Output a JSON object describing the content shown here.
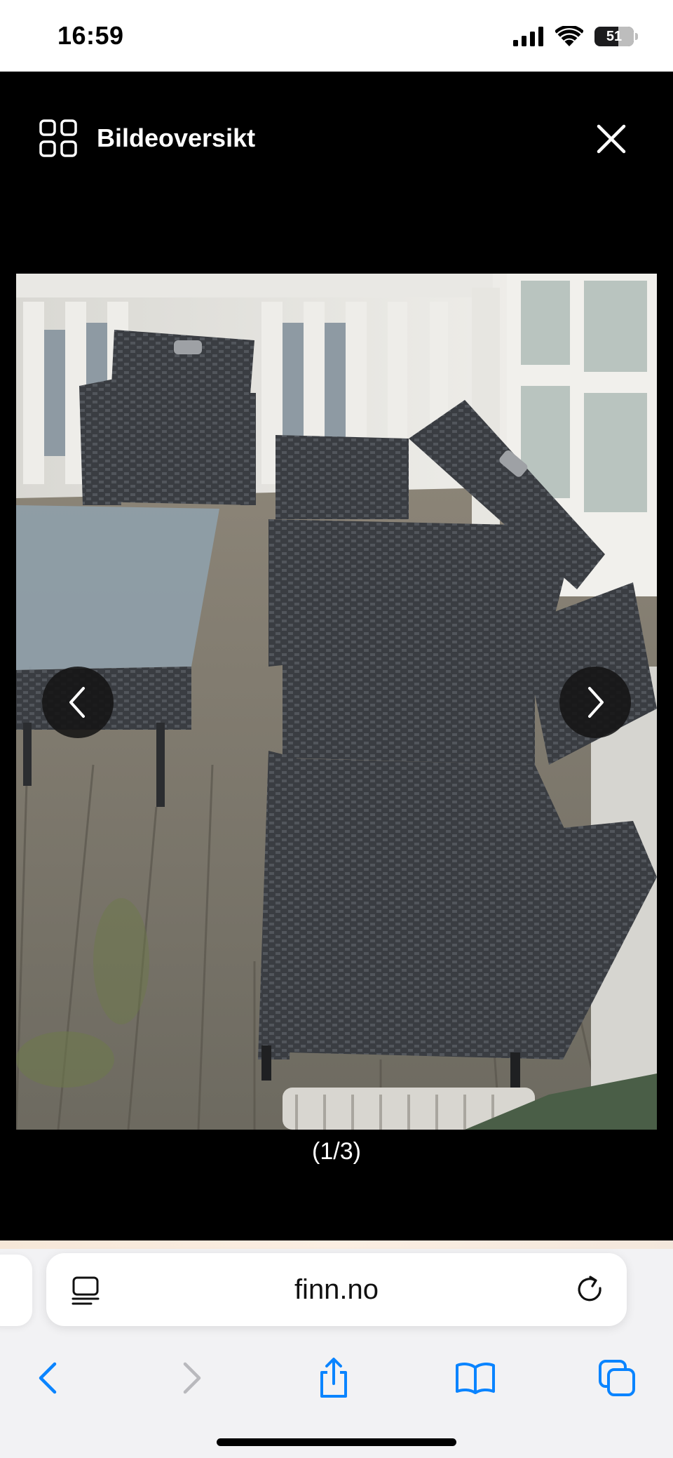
{
  "status": {
    "time": "16:59",
    "battery": "51"
  },
  "viewer": {
    "overview_label": "Bildeoversikt",
    "counter": "(1/3)"
  },
  "browser": {
    "url": "finn.no"
  },
  "icons": {
    "overview": "grid-icon",
    "close": "close-icon",
    "prev": "chevron-left-icon",
    "next": "chevron-right-icon",
    "reader": "reader-mode-icon",
    "reload": "reload-icon",
    "back": "back-icon",
    "forward": "forward-icon",
    "share": "share-icon",
    "bookmarks": "bookmarks-icon",
    "tabs": "tabs-icon"
  },
  "colors": {
    "viewer_bg": "#000000",
    "safari_blue": "#0a84ff",
    "toolbar_bg": "#f2f2f4"
  }
}
